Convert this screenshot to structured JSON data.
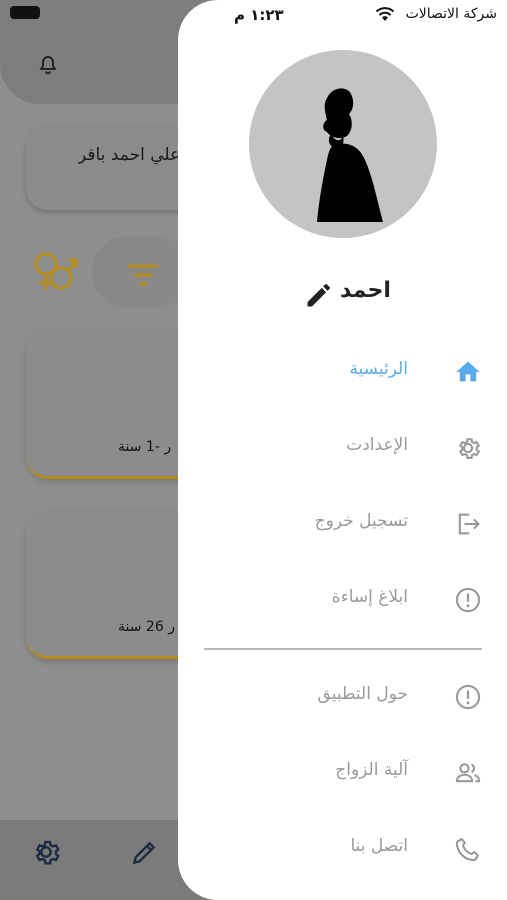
{
  "status_bar": {
    "time": "١:٢٣ م",
    "carrier": "شركة الاتصالات"
  },
  "background": {
    "name_text": "علي احمد باقر",
    "card1_text": "ر -1 سنة",
    "card2_text": "ر 26 سنة",
    "accent_color": "#b68d1c"
  },
  "drawer": {
    "user_name": "احمد",
    "menu": [
      {
        "label": "الرئيسية",
        "icon": "home-icon",
        "active": true
      },
      {
        "label": "الإعدادت",
        "icon": "settings-gear-icon",
        "active": false
      },
      {
        "label": "تسجيل خروج",
        "icon": "logout-icon",
        "active": false
      },
      {
        "label": "ابلاغ إساءة",
        "icon": "report-alert-icon",
        "active": false
      },
      {
        "label": "حول التطبيق",
        "icon": "info-alert-icon",
        "active": false
      },
      {
        "label": "آلية الزواج",
        "icon": "people-icon",
        "active": false
      },
      {
        "label": "اتصل بنا",
        "icon": "phone-icon",
        "active": false
      }
    ],
    "active_color": "#5aaae8",
    "inactive_color": "#9a9a9a"
  }
}
